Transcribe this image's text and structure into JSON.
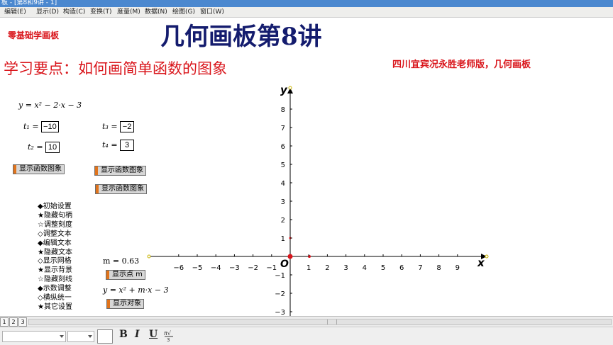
{
  "window": {
    "title": "板 - [第8和9讲 - 1]"
  },
  "menubar": {
    "items": [
      "编辑(E)",
      "显示(D)",
      "构造(C)",
      "变换(T)",
      "度量(M)",
      "数据(N)",
      "绘图(G)",
      "窗口(W)"
    ]
  },
  "page": {
    "corner_label": "零基础学画板",
    "lecture_title": "几何画板第8讲",
    "key_point": "学习要点：如何画简单函数的图象",
    "author": "四川宜宾况永胜老师版，几何画板"
  },
  "function1": {
    "label": "y = x² − 2·x − 3"
  },
  "params": {
    "t1_label": "t₁ =",
    "t1_value": "−10",
    "t2_label": "t₂ =",
    "t2_value": "10",
    "t3_label": "t₃ =",
    "t3_value": "−2",
    "t4_label": "t₄ =",
    "t4_value": "3"
  },
  "buttons": {
    "show_graph": "显示函数图象",
    "show_point_m": "显示点 m",
    "show_object": "显示对象"
  },
  "side_menu": {
    "items": [
      "◆初始设置",
      "★隐藏句柄",
      "☆调整刻度",
      "◇调整文本",
      "◆编辑文本",
      "★隐藏文本",
      "◇显示网格",
      "★显示背景",
      "☆隐藏刻线",
      "◆示数调整",
      "◇横纵统一",
      "★其它设置"
    ]
  },
  "m_param": {
    "label": "m = 0.63"
  },
  "function2": {
    "label": "y = x² + m·x − 3"
  },
  "axes": {
    "x_label": "x",
    "y_label": "y",
    "origin_label": "O",
    "x_min": -7,
    "x_max": 10,
    "y_min": -3,
    "y_max": 9,
    "x_ticks": [
      -6,
      -5,
      -4,
      -3,
      -2,
      -1,
      1,
      2,
      3,
      4,
      5,
      6,
      7,
      8,
      9
    ],
    "y_ticks": [
      8,
      7,
      6,
      5,
      4,
      3,
      2,
      1,
      -1,
      -2,
      -3
    ]
  },
  "statusbar": {
    "pages": [
      "1",
      "2",
      "3"
    ]
  },
  "format_toolbar": {
    "bold": "B",
    "italic": "I",
    "underline": "U"
  },
  "colors": {
    "accent_red": "#d9151b",
    "title_navy": "#141c6e",
    "button_orange": "#e0731b"
  }
}
